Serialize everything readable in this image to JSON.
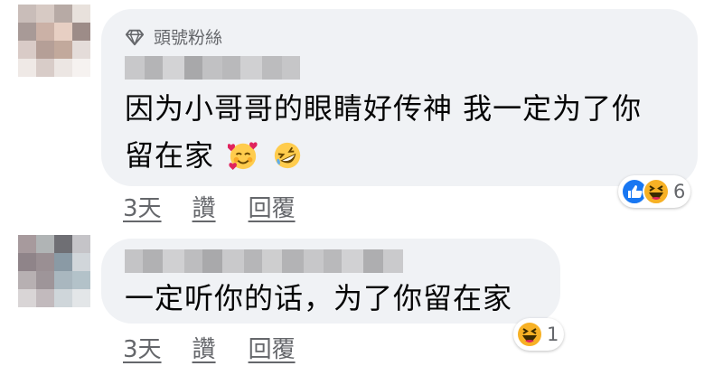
{
  "comments": [
    {
      "badge": "頭號粉絲",
      "text_line1": "因为小哥哥的眼睛好传神 我一定为了你",
      "text_line2": "留在家",
      "emojis": [
        "smiling-face-with-hearts-icon",
        "rolling-on-floor-laughing-icon"
      ],
      "actions": {
        "time": "3天",
        "like": "讚",
        "reply": "回覆"
      },
      "reactions": {
        "icons": [
          "like-icon",
          "haha-icon"
        ],
        "count": "6"
      }
    },
    {
      "text_line1": "一定听你的话，为了你留在家",
      "actions": {
        "time": "3天",
        "like": "讚",
        "reply": "回覆"
      },
      "reactions": {
        "icons": [
          "haha-icon"
        ],
        "count": "1"
      }
    }
  ],
  "colors": {
    "bubble": "#f0f2f5",
    "meta_text": "#65676b",
    "like_blue": "#1877f2",
    "haha_yellow": "#f7b125"
  }
}
